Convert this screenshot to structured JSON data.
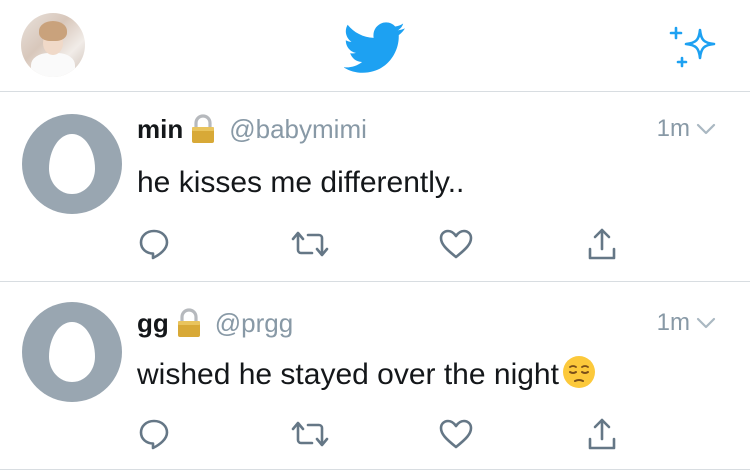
{
  "header": {
    "profile_avatar": "profile-photo",
    "logo_icon": "twitter-bird-icon",
    "sparkle_icon": "sparkle-icon"
  },
  "tweets": [
    {
      "name": "min",
      "handle": "@babymimi",
      "time": "1m",
      "text": "he kisses me differently..",
      "emoji": "",
      "protected": true
    },
    {
      "name": "gg",
      "handle": "@prgg",
      "time": "1m",
      "text": "wished he stayed over the night",
      "emoji": "pensive-face-emoji",
      "protected": true
    }
  ],
  "colors": {
    "twitter_blue": "#1da1f2",
    "gray_text": "#8899a6",
    "icon_gray": "#657786",
    "divider": "#d8dde1",
    "egg_bg": "#99a6b1"
  }
}
